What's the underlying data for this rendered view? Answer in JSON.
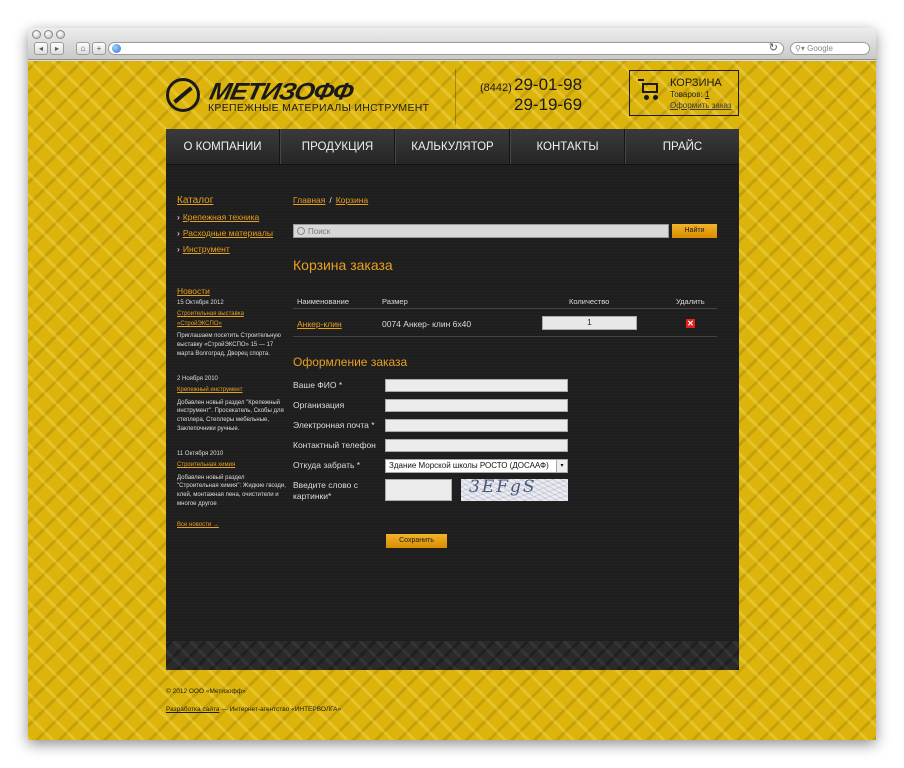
{
  "browser": {
    "url": "",
    "search_placeholder": "Google"
  },
  "header": {
    "logo_name": "МЕТИЗОФФ",
    "logo_tagline": "КРЕПЕЖНЫЕ МАТЕРИАЛЫ ИНСТРУМЕНТ",
    "phone_code": "(8442)",
    "phone_1": "29-01-98",
    "phone_2": "29-19-69",
    "cart_title": "КОРЗИНА",
    "cart_items_label": "Товаров:",
    "cart_items_count": "1",
    "cart_checkout_link": "Оформить заказ"
  },
  "menu": [
    {
      "label": "О КОМПАНИИ"
    },
    {
      "label": "ПРОДУКЦИЯ"
    },
    {
      "label": "КАЛЬКУЛЯТОР"
    },
    {
      "label": "КОНТАКТЫ"
    },
    {
      "label": "ПРАЙС"
    }
  ],
  "sidebar": {
    "catalog_title": "Каталог",
    "catalog_items": [
      {
        "label": "Крепежная техника"
      },
      {
        "label": "Расходные материалы"
      },
      {
        "label": "Инструмент"
      }
    ],
    "news_title": "Новости",
    "news": [
      {
        "date": "15 Октября 2012",
        "headline": "Строительная выставка «СтройЭКСПО»",
        "text": "Приглашаем посетить Строительную выставку «СтройЭКСПО» 15 — 17 марта Волгоград, Дворец спорта."
      },
      {
        "date": "2 Ноября 2010",
        "headline": "Крепежный инструмент",
        "text": "Добавлен новый раздел \"Крепежный инструмент\". Просекатель, Скобы для степлера, Степлеры мебельные, Заклепочники ручные."
      },
      {
        "date": "11 Октября 2010",
        "headline": "Строительная химия",
        "text": "Добавлен новый раздел \"Строительная химия\": Жидкие гвозди, клей, монтажная пена, очистители и многое другое"
      }
    ],
    "all_news": "Все новости →"
  },
  "main": {
    "breadcrumb_home": "Главная",
    "breadcrumb_sep": "/",
    "breadcrumb_current": "Корзина",
    "search_placeholder": "Поиск",
    "search_button": "Найти",
    "cart_heading": "Корзина заказа",
    "table": {
      "headers": [
        "Наименование",
        "Размер",
        "Количество",
        "Удалить"
      ],
      "rows": [
        {
          "name": "Анкер-клин",
          "size": "0074 Анкер- клин 6х40",
          "qty": "1"
        }
      ]
    },
    "order_heading": "Оформление заказа",
    "form": {
      "name_label": "Ваше ФИО *",
      "org_label": "Организация",
      "email_label": "Электронная почта *",
      "phone_label": "Контактный телефон",
      "pickup_label": "Откуда забрать *",
      "pickup_value": "Здание Морской школы РОСТО (ДОСААФ)",
      "captcha_label": "Введите слово с картинки*",
      "captcha_text": "3EFgS",
      "save_button": "Сохранить"
    }
  },
  "footer": {
    "copyright": "© 2012 ООО «Метизофф»",
    "dev_link": "Разработка сайта",
    "dev_text": "— Интернет-агентство «ИНТЕРВОЛГА»"
  },
  "colors": {
    "accent": "#e8a020",
    "page_bg": "#dcb40c",
    "site_bg": "#1e1e1e",
    "button": "#e8a010",
    "delete": "#e0221b"
  }
}
